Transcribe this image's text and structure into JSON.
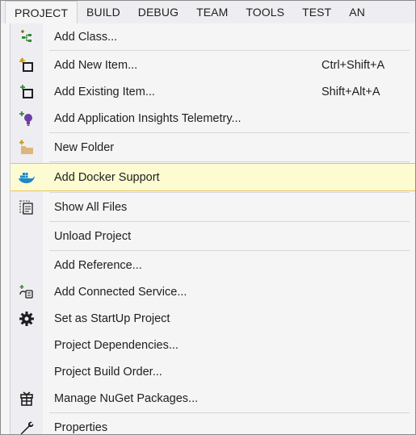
{
  "menubar": {
    "items": [
      "PROJECT",
      "BUILD",
      "DEBUG",
      "TEAM",
      "TOOLS",
      "TEST",
      "AN"
    ]
  },
  "menu": {
    "items": [
      {
        "label": "Add Class...",
        "shortcut": "",
        "icon": "add-class-icon"
      },
      {
        "label": "Add New Item...",
        "shortcut": "Ctrl+Shift+A",
        "icon": "add-new-item-icon"
      },
      {
        "label": "Add Existing Item...",
        "shortcut": "Shift+Alt+A",
        "icon": "add-existing-item-icon"
      },
      {
        "label": "Add Application Insights Telemetry...",
        "shortcut": "",
        "icon": "lightbulb-icon"
      },
      {
        "label": "New Folder",
        "shortcut": "",
        "icon": "new-folder-icon"
      },
      {
        "label": "Add Docker Support",
        "shortcut": "",
        "icon": "docker-icon"
      },
      {
        "label": "Show All Files",
        "shortcut": "",
        "icon": "show-all-files-icon"
      },
      {
        "label": "Unload Project",
        "shortcut": "",
        "icon": ""
      },
      {
        "label": "Add Reference...",
        "shortcut": "",
        "icon": ""
      },
      {
        "label": "Add Connected Service...",
        "shortcut": "",
        "icon": "connected-service-icon"
      },
      {
        "label": "Set as StartUp Project",
        "shortcut": "",
        "icon": "gear-icon"
      },
      {
        "label": "Project Dependencies...",
        "shortcut": "",
        "icon": ""
      },
      {
        "label": "Project Build Order...",
        "shortcut": "",
        "icon": ""
      },
      {
        "label": "Manage NuGet Packages...",
        "shortcut": "",
        "icon": "nuget-icon"
      },
      {
        "label": "Properties",
        "shortcut": "",
        "icon": "wrench-icon"
      }
    ],
    "highlighted_label": "Add Docker Support"
  },
  "colors": {
    "highlight_bg": "#fdfbd2",
    "highlight_border": "#e5c365",
    "menu_bg": "#f5f5f5",
    "gutter_bg": "#eeeef2",
    "icon_green": "#388a34",
    "icon_purple": "#6c3fa6",
    "docker_blue": "#1e88c7"
  }
}
